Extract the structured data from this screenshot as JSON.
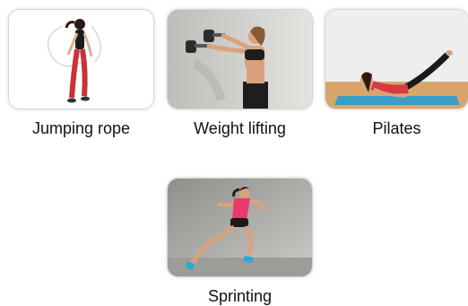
{
  "exercises": [
    {
      "label": "Jumping rope",
      "icon": "jumping-rope-photo"
    },
    {
      "label": "Weight lifting",
      "icon": "weight-lifting-photo"
    },
    {
      "label": "Pilates",
      "icon": "pilates-photo"
    },
    {
      "label": "Sprinting",
      "icon": "sprinting-photo"
    }
  ],
  "colors": {
    "card_border": "#d6d6d6",
    "text": "#111111"
  }
}
